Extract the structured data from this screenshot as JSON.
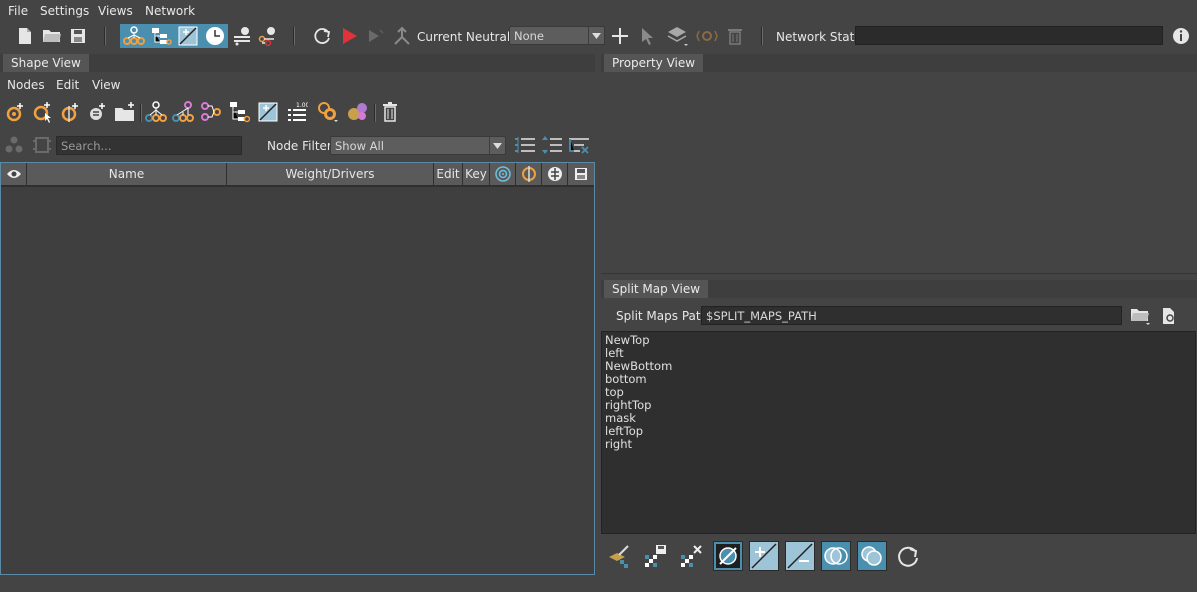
{
  "menubar": {
    "items": [
      "File",
      "Settings",
      "Views",
      "Network"
    ]
  },
  "toolbar": {
    "current_neutral_label": "Current Neutral:",
    "current_neutral_value": "None",
    "network_state_label": "Network State:",
    "network_state_value": "",
    "toggles": [
      {
        "icon": "node-hierarchy-icon",
        "active": true
      },
      {
        "icon": "tree-nodes-icon",
        "active": true
      },
      {
        "icon": "weight-graph-icon",
        "active": true
      },
      {
        "icon": "clock-icon",
        "active": true
      }
    ]
  },
  "shape_view": {
    "tab": "Shape View",
    "menu": [
      "Nodes",
      "Edit",
      "View"
    ],
    "search_placeholder": "Search...",
    "node_filter_label": "Node Filter:",
    "node_filter_value": "Show All",
    "columns": [
      "Name",
      "Weight/Drivers",
      "Edit",
      "Key"
    ]
  },
  "property_view": {
    "tab": "Property View"
  },
  "split_map_view": {
    "tab": "Split Map View",
    "path_label": "Split Maps Path:",
    "path_value": "$SPLIT_MAPS_PATH",
    "maps": [
      "NewTop",
      "left",
      "NewBottom",
      "bottom",
      "top",
      "rightTop",
      "mask",
      "leftTop",
      "right"
    ]
  },
  "colors": {
    "accent": "#4b8fae",
    "play": "#e0323a",
    "node_orange": "#f0a040",
    "node_pink": "#d77ad6"
  }
}
